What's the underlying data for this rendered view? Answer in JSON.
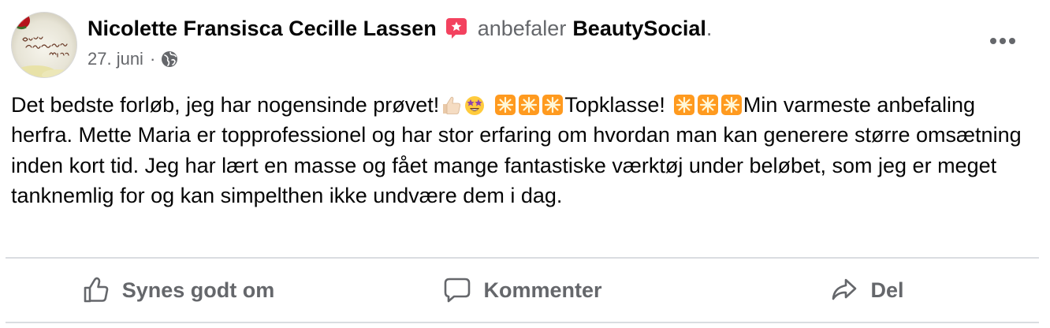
{
  "post": {
    "author": "Nicolette Fransisca Cecille Lassen",
    "recommends_text": "anbefaler",
    "page_name": "BeautySocial",
    "period": ".",
    "date": "27. juni",
    "separator": "·",
    "avatar_text": "Buon Compleanno Miss",
    "text": {
      "s1": "Det bedste forløb, jeg har nogensinde prøvet!",
      "s2": "Topklasse!",
      "s3": "Min varmeste anbefaling herfra. Mette Maria er topprofessionel og har stor erfaring om hvordan man kan generere større omsætning inden kort tid. Jeg har lært en masse og fået mange fantastiske værktøj under beløbet, som jeg er meget tanknemlig for og kan simpelthen ikke undvære dem i dag."
    }
  },
  "actions": {
    "like_label": "Synes godt om",
    "comment_label": "Kommenter",
    "share_label": "Del"
  },
  "icons": {
    "recommend_badge": "recommend-star-icon",
    "privacy": "globe-icon",
    "more": "more-options-icon",
    "like": "thumbs-up-icon",
    "comment": "comment-bubble-icon",
    "share": "share-arrow-icon"
  },
  "emojis": [
    "thumbs-up-light-skin",
    "star-struck",
    "sparkle-star",
    "sparkle-star",
    "sparkle-star",
    "sparkle-star",
    "sparkle-star",
    "sparkle-star"
  ],
  "colors": {
    "text_primary": "#050505",
    "text_secondary": "#65676b",
    "divider": "#dadde1",
    "recommend_badge": "#f3425f"
  }
}
